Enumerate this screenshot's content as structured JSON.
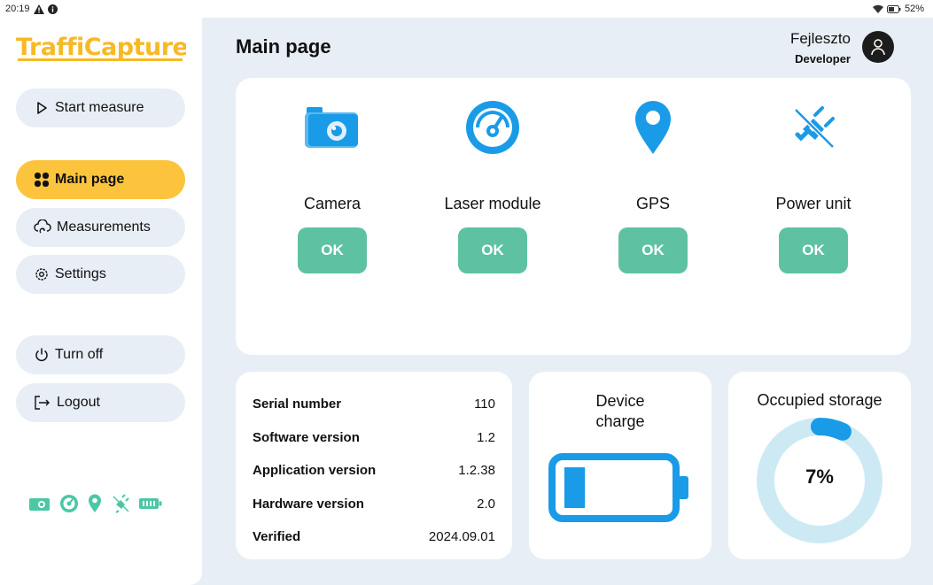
{
  "status_bar": {
    "time": "20:19",
    "battery": "52%"
  },
  "app": {
    "logo_text": "TraffiCapture"
  },
  "sidebar": {
    "start_measure": "Start measure",
    "main_page": "Main page",
    "measurements": "Measurements",
    "settings": "Settings",
    "turn_off": "Turn off",
    "logout": "Logout"
  },
  "header": {
    "title": "Main page",
    "user_name": "Fejleszto",
    "user_role": "Developer"
  },
  "modules": [
    {
      "name": "Camera",
      "status": "OK",
      "icon": "camera-icon"
    },
    {
      "name": "Laser module",
      "status": "OK",
      "icon": "speedometer-icon"
    },
    {
      "name": "GPS",
      "status": "OK",
      "icon": "location-pin-icon"
    },
    {
      "name": "Power unit",
      "status": "OK",
      "icon": "plug-off-icon"
    }
  ],
  "device_info": {
    "serial_label": "Serial number",
    "serial_value": "110",
    "software_label": "Software version",
    "software_value": "1.2",
    "application_label": "Application version",
    "application_value": "1.2.38",
    "hardware_label": "Hardware version",
    "hardware_value": "2.0",
    "verified_label": "Verified",
    "verified_value": "2024.09.01"
  },
  "charge": {
    "title_line1": "Device",
    "title_line2": "charge",
    "level": 0.2
  },
  "storage": {
    "title": "Occupied storage",
    "percent_label": "7%",
    "percent": 7
  },
  "colors": {
    "accent": "#fcc43c",
    "ok": "#5ec2a2",
    "icon_blue": "#1a9be8",
    "background": "#e8eef5"
  }
}
